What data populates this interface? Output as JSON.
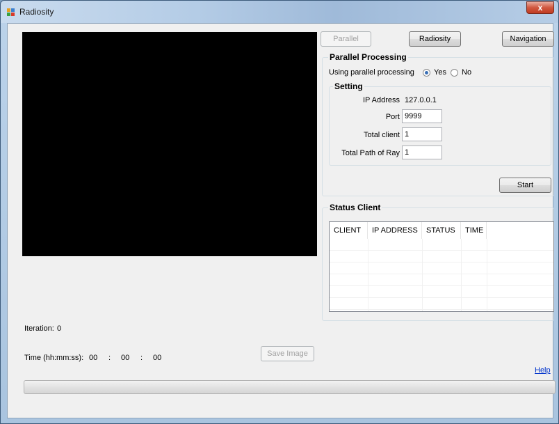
{
  "window": {
    "title": "Radiosity",
    "close_glyph": "x"
  },
  "toolbar": {
    "parallel_label": "Parallel",
    "radiosity_label": "Radiosity",
    "navigation_label": "Navigation"
  },
  "parallel_processing": {
    "title": "Parallel Processing",
    "using_label": "Using parallel processing",
    "yes_label": "Yes",
    "no_label": "No",
    "selected": "Yes",
    "setting": {
      "title": "Setting",
      "ip_label": "IP Address",
      "ip_value": "127.0.0.1",
      "port_label": "Port",
      "port_value": "9999",
      "total_client_label": "Total client",
      "total_client_value": "1",
      "total_path_label": "Total Path of Ray",
      "total_path_value": "1"
    },
    "start_label": "Start"
  },
  "status_client": {
    "title": "Status Client",
    "columns": [
      "CLIENT",
      "IP ADDRESS",
      "STATUS",
      "TIME"
    ],
    "rows": []
  },
  "iteration": {
    "label": "Iteration:",
    "value": "0"
  },
  "time": {
    "label": "Time (hh:mm:ss):",
    "hh": "00",
    "sep1": ":",
    "mm": "00",
    "sep2": ":",
    "ss": "00"
  },
  "save_image_label": "Save Image",
  "help_label": "Help",
  "progress": {
    "percent": 0
  },
  "colors": {
    "accent": "#3a6fb5",
    "link": "#0033cc",
    "render_background": "#000000"
  },
  "icons": {
    "app": "radiosity-app-icon",
    "close": "close-icon"
  }
}
